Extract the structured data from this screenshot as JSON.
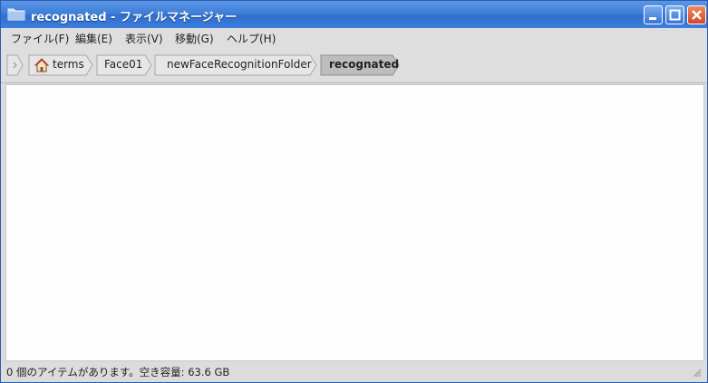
{
  "window": {
    "title": "recognated - ファイルマネージャー",
    "controls": {
      "minimize": "minimize",
      "maximize": "maximize",
      "close": "close"
    }
  },
  "menu": {
    "items": [
      {
        "label": "ファイル(F)"
      },
      {
        "label": "編集(E)"
      },
      {
        "label": "表示(V)"
      },
      {
        "label": "移動(G)"
      },
      {
        "label": "ヘルプ(H)"
      }
    ]
  },
  "path": {
    "crumbs": [
      {
        "label": "terms",
        "icon": "home-icon"
      },
      {
        "label": "Face01"
      },
      {
        "label": "newFaceRecognitionFolder"
      },
      {
        "label": "recognated",
        "active": true
      }
    ]
  },
  "status": {
    "text": "0 個のアイテムがあります。空き容量: 63.6 GB"
  },
  "colors": {
    "titlebar": "#3f7fd9",
    "close_button": "#d3462a",
    "content_bg": "#fdfdfd"
  }
}
